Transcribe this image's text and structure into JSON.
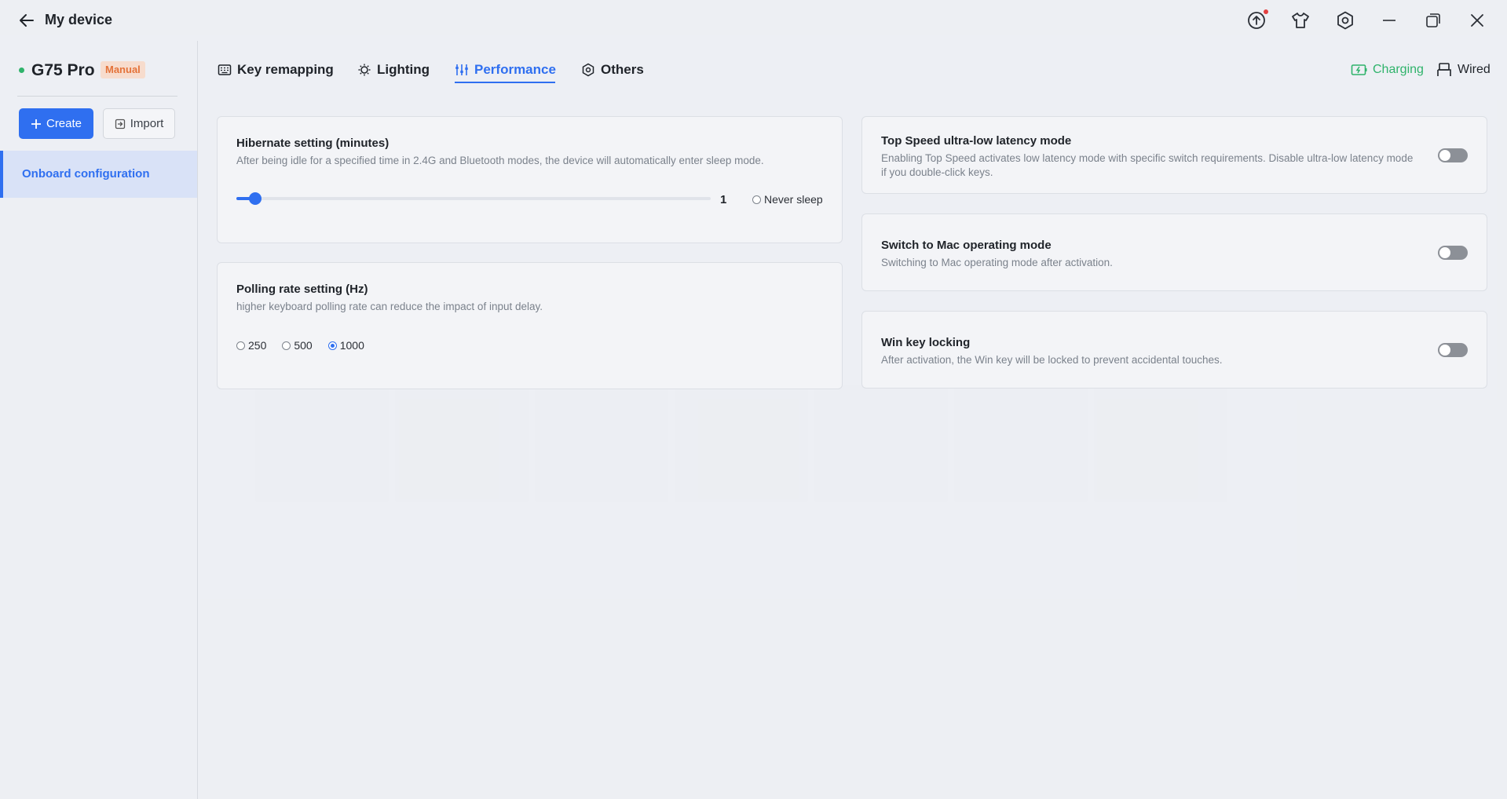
{
  "window": {
    "title": "My device"
  },
  "device": {
    "name": "G75 Pro",
    "mode": "Manual"
  },
  "sidebar": {
    "create_label": "Create",
    "import_label": "Import",
    "items": [
      {
        "label": "Onboard configuration",
        "active": true
      }
    ]
  },
  "tabs": [
    {
      "label": "Key remapping",
      "icon": "keyboard-icon",
      "active": false
    },
    {
      "label": "Lighting",
      "icon": "bulb-icon",
      "active": false
    },
    {
      "label": "Performance",
      "icon": "sliders-icon",
      "active": true
    },
    {
      "label": "Others",
      "icon": "hexagon-settings-icon",
      "active": false
    }
  ],
  "status": {
    "charging": "Charging",
    "connection": "Wired"
  },
  "colors": {
    "accent": "#2f6ff0",
    "charging": "#2fb36b",
    "badge": "#e4733a"
  },
  "hibernate": {
    "title": "Hibernate setting (minutes)",
    "description": "After being idle for a specified time in 2.4G and Bluetooth modes, the device will automatically enter sleep mode.",
    "value": "1",
    "slider_fraction": 0.04,
    "never_sleep_label": "Never sleep",
    "never_sleep": false
  },
  "polling": {
    "title": "Polling rate setting (Hz)",
    "description": "higher keyboard polling rate can reduce the impact of input delay.",
    "options": [
      "250",
      "500",
      "1000"
    ],
    "selected": "1000"
  },
  "toggles": [
    {
      "title": "Top Speed ultra-low latency mode",
      "description": "Enabling Top Speed activates low latency mode with specific switch requirements. Disable ultra-low latency mode if you double-click keys.",
      "enabled": false
    },
    {
      "title": "Switch to Mac operating mode",
      "description": "Switching to Mac operating mode after activation.",
      "enabled": false
    },
    {
      "title": "Win key locking",
      "description": "After activation, the Win key will be locked to prevent accidental touches.",
      "enabled": false
    }
  ]
}
